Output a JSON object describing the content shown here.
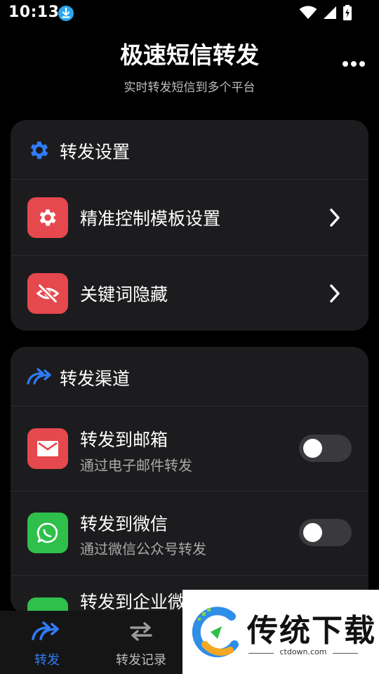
{
  "status_bar": {
    "time": "10:13"
  },
  "header": {
    "title": "极速短信转发",
    "subtitle": "实时转发短信到多个平台"
  },
  "forward_settings": {
    "title": "转发设置",
    "items": [
      {
        "label": "精准控制模板设置",
        "icon": "gear-icon"
      },
      {
        "label": "关键词隐藏",
        "icon": "eye-off-icon"
      }
    ]
  },
  "forward_channels": {
    "title": "转发渠道",
    "items": [
      {
        "label": "转发到邮箱",
        "sub": "通过电子邮件转发",
        "icon": "mail-icon",
        "enabled": false
      },
      {
        "label": "转发到微信",
        "sub": "通过微信公众号转发",
        "icon": "chat-bubble-icon",
        "enabled": false
      },
      {
        "label": "转发到企业微",
        "icon": "partial-channel-icon"
      }
    ]
  },
  "bottom_nav": {
    "items": [
      {
        "label": "转发",
        "active": true
      },
      {
        "label": "转发记录",
        "active": false
      }
    ]
  },
  "watermark": {
    "brand": "传统下载",
    "url": "ctdown.com"
  },
  "colors": {
    "accent": "#2f7cf6",
    "red_tile": "#e5484d",
    "green_tile": "#2fbf4b",
    "card_bg": "#1c1c1e",
    "toggle_off": "#3a3a3d"
  }
}
